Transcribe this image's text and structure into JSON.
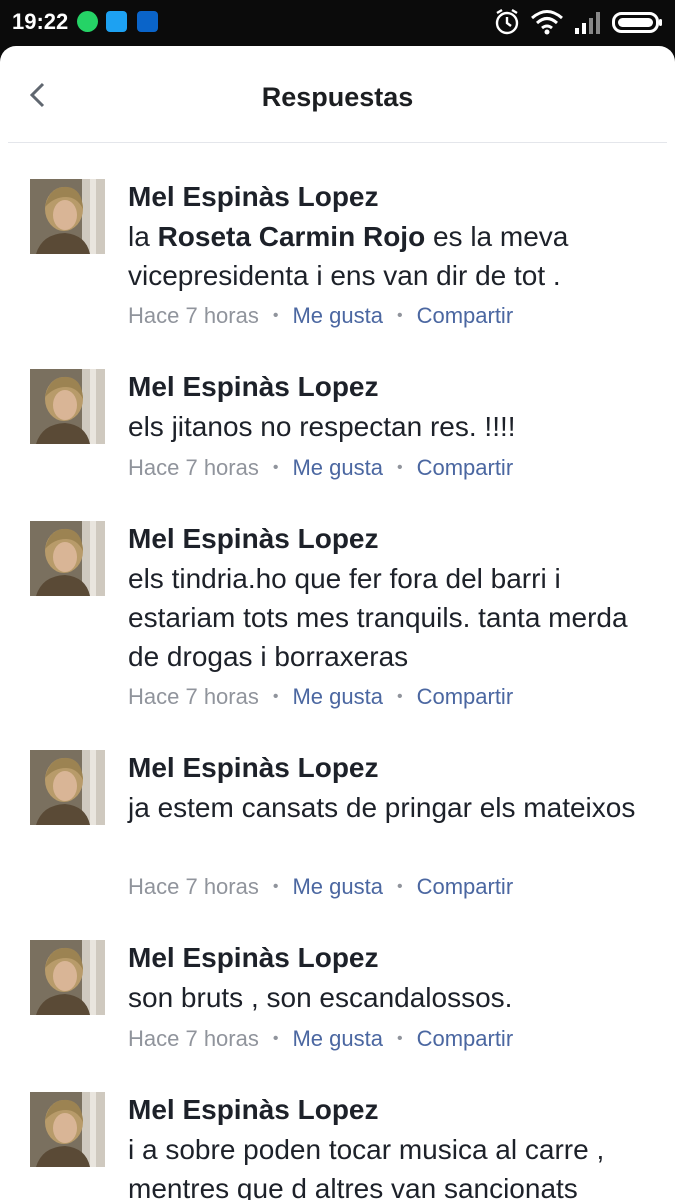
{
  "status": {
    "time": "19:22"
  },
  "header": {
    "title": "Respuestas"
  },
  "comments": [
    {
      "author": "Mel Espinàs Lopez",
      "mention": "Roseta Carmin Rojo",
      "pre": "la ",
      "post": " es la meva vicepresidenta i ens van dir de tot .",
      "time": "Hace 7 horas",
      "like": "Me gusta",
      "share": "Compartir"
    },
    {
      "author": "Mel Espinàs Lopez",
      "text": "els jitanos no respectan res. !!!!",
      "time": "Hace 7 horas",
      "like": "Me gusta",
      "share": "Compartir"
    },
    {
      "author": "Mel Espinàs Lopez",
      "text": "els tindria.ho que fer fora del barri i estariam tots mes tranquils. tanta merda de drogas i borraxeras",
      "time": "Hace 7 horas",
      "like": "Me gusta",
      "share": "Compartir"
    },
    {
      "author": "Mel Espinàs Lopez",
      "text": "ja estem cansats de pringar els mateixos",
      "time": "Hace 7 horas",
      "like": "Me gusta",
      "share": "Compartir"
    },
    {
      "author": "Mel Espinàs Lopez",
      "text": "son bruts , son escandalossos.",
      "time": "Hace 7 horas",
      "like": "Me gusta",
      "share": "Compartir"
    },
    {
      "author": "Mel Espinàs Lopez",
      "text": "i a sobre poden tocar musica al carre , mentres que d altres van sancionats",
      "time": "",
      "like": "",
      "share": ""
    }
  ]
}
